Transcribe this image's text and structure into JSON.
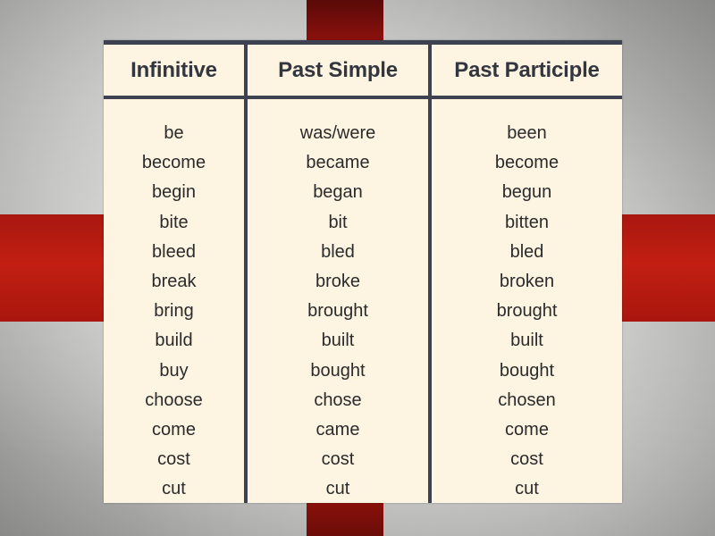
{
  "background": {
    "flag": "St George's Cross",
    "colors": {
      "red": "#b8190f",
      "white": "#d2d2d0"
    }
  },
  "table": {
    "columns": [
      {
        "header": "Infinitive",
        "cells": [
          "be",
          "become",
          "begin",
          "bite",
          "bleed",
          "break",
          "bring",
          "build",
          "buy",
          "choose",
          "come",
          "cost",
          "cut"
        ]
      },
      {
        "header": "Past Simple",
        "cells": [
          "was/were",
          "became",
          "began",
          "bit",
          "bled",
          "broke",
          "brought",
          "built",
          "bought",
          "chose",
          "came",
          "cost",
          "cut"
        ]
      },
      {
        "header": "Past Participle",
        "cells": [
          "been",
          "become",
          "begun",
          "bitten",
          "bled",
          "broken",
          "brought",
          "built",
          "bought",
          "chosen",
          "come",
          "cost",
          "cut"
        ]
      }
    ]
  }
}
